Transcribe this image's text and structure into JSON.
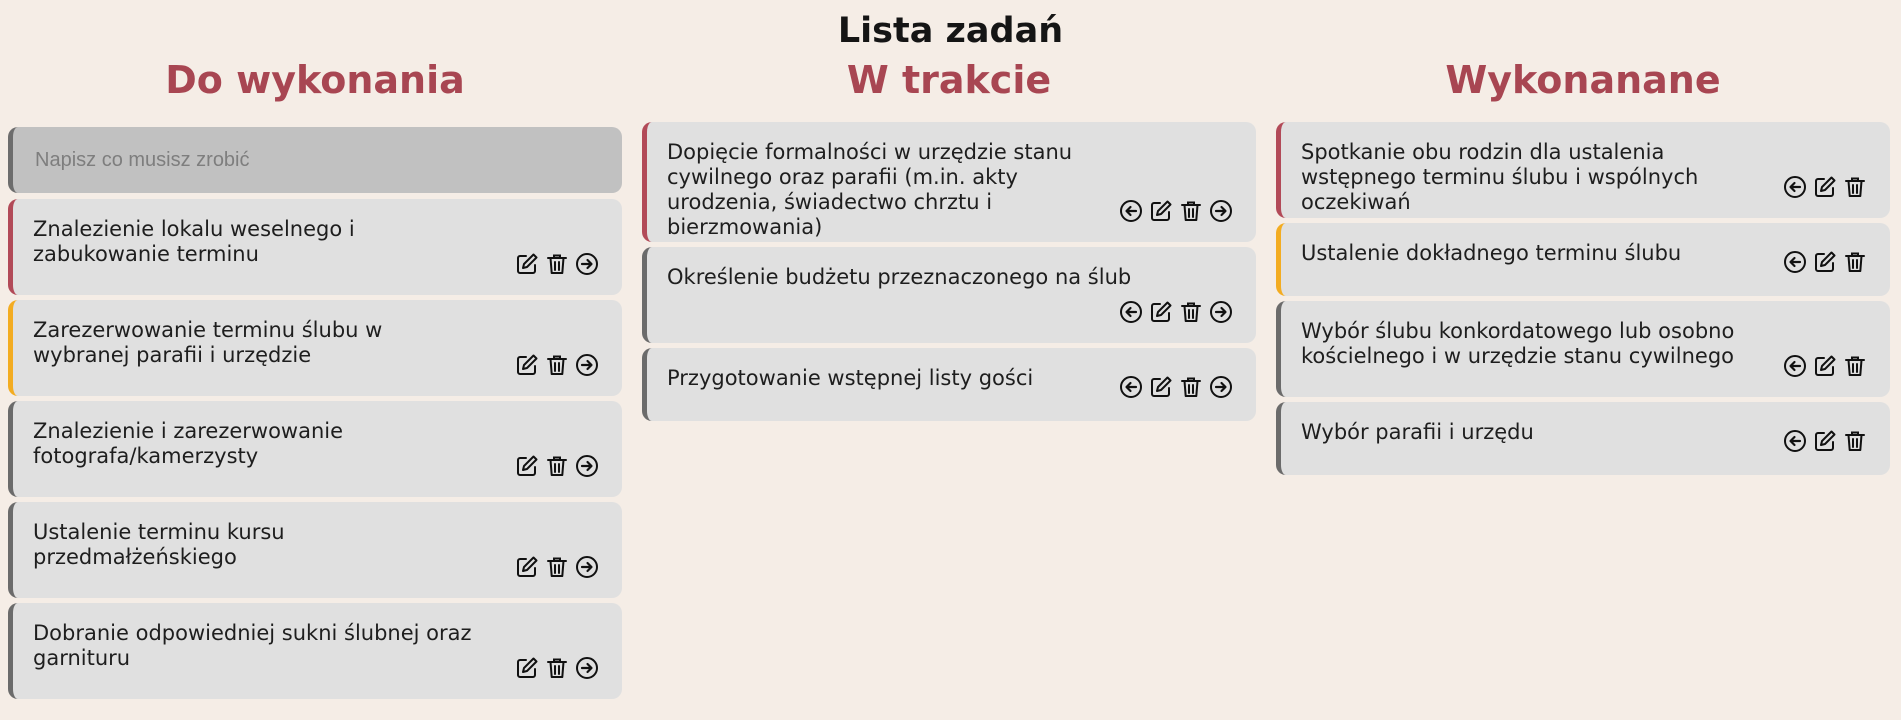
{
  "page": {
    "title": "Lista zadań"
  },
  "columns": {
    "todo": {
      "title": "Do wykonania",
      "input_placeholder": "Napisz co musisz zrobić",
      "cards": [
        {
          "text": "Znalezienie lokalu weselnego i zabukowanie terminu",
          "priority": "high",
          "color": "#b24a58"
        },
        {
          "text": "Zarezerwowanie terminu ślubu w wybranej parafii i urzędzie",
          "priority": "medium",
          "color": "#f3ac21"
        },
        {
          "text": "Znalezienie i zarezerwowanie fotografa/kamerzysty",
          "priority": "low",
          "color": "#6b6b6b"
        },
        {
          "text": "Ustalenie terminu kursu przedmałżeńskiego",
          "priority": "low",
          "color": "#6b6b6b"
        },
        {
          "text": "Dobranie odpowiedniej sukni ślubnej oraz garnituru",
          "priority": "low",
          "color": "#6b6b6b"
        }
      ]
    },
    "progress": {
      "title": "W trakcie",
      "cards": [
        {
          "text": "Dopięcie formalności w urzędzie stanu cywilnego oraz parafii (m.in. akty urodzenia, świadectwo chrztu i bierzmowania)",
          "priority": "high",
          "color": "#b24a58"
        },
        {
          "text": "Określenie budżetu przeznaczonego na ślub",
          "priority": "low",
          "color": "#6b6b6b"
        },
        {
          "text": "Przygotowanie wstępnej listy gości",
          "priority": "low",
          "color": "#6b6b6b"
        }
      ]
    },
    "done": {
      "title": "Wykonanane",
      "cards": [
        {
          "text": "Spotkanie obu rodzin dla ustalenia wstępnego terminu ślubu i wspólnych oczekiwań",
          "priority": "high",
          "color": "#b24a58"
        },
        {
          "text": "Ustalenie dokładnego terminu ślubu",
          "priority": "medium",
          "color": "#f3ac21"
        },
        {
          "text": "Wybór ślubu konkordatowego lub osobno kościelnego i w urzędzie stanu cywilnego",
          "priority": "low",
          "color": "#6b6b6b"
        },
        {
          "text": "Wybór parafii i urzędu",
          "priority": "low",
          "color": "#6b6b6b"
        }
      ]
    }
  },
  "icons": {
    "move_back": "arrow-left-circle-icon",
    "edit": "edit-icon",
    "delete": "trash-icon",
    "move_forward": "arrow-right-circle-icon"
  },
  "colors": {
    "background": "#f5ede6",
    "column_title": "#a84652",
    "card": "#e0e0e0",
    "input": "#c1c1c1"
  }
}
